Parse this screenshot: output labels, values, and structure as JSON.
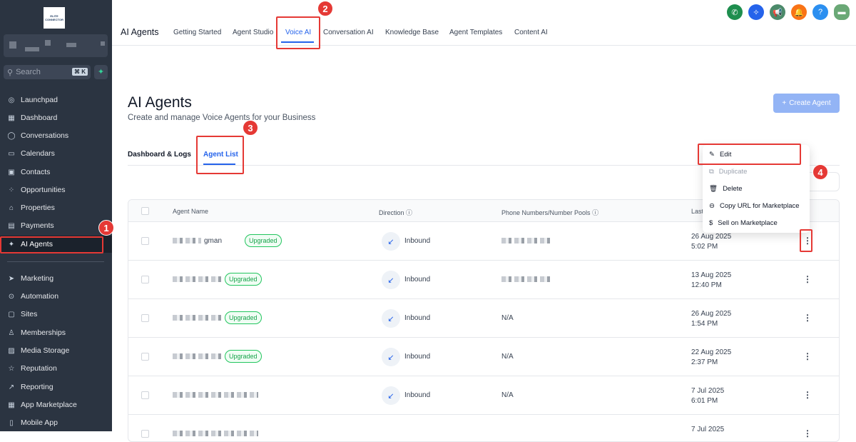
{
  "sidebar": {
    "logo_text": "ELITE CONNECTOR",
    "search_placeholder": "Search",
    "shortcut": "⌘ K",
    "items": [
      {
        "label": "Launchpad",
        "icon": "◎"
      },
      {
        "label": "Dashboard",
        "icon": "▦"
      },
      {
        "label": "Conversations",
        "icon": "◯"
      },
      {
        "label": "Calendars",
        "icon": "▭"
      },
      {
        "label": "Contacts",
        "icon": "▣"
      },
      {
        "label": "Opportunities",
        "icon": "⁘"
      },
      {
        "label": "Properties",
        "icon": "⌂"
      },
      {
        "label": "Payments",
        "icon": "▤"
      },
      {
        "label": "AI Agents",
        "icon": "✦",
        "active": true
      },
      {
        "label": "Marketing",
        "icon": "➤"
      },
      {
        "label": "Automation",
        "icon": "⊙"
      },
      {
        "label": "Sites",
        "icon": "▢"
      },
      {
        "label": "Memberships",
        "icon": "♙"
      },
      {
        "label": "Media Storage",
        "icon": "▨"
      },
      {
        "label": "Reputation",
        "icon": "☆"
      },
      {
        "label": "Reporting",
        "icon": "↗"
      },
      {
        "label": "App Marketplace",
        "icon": "▦"
      },
      {
        "label": "Mobile App",
        "icon": "▯"
      }
    ]
  },
  "header": {
    "title": "AI Agents",
    "tabs": [
      "Getting Started",
      "Agent Studio",
      "Voice AI",
      "Conversation AI",
      "Knowledge Base",
      "Agent Templates",
      "Content AI"
    ],
    "active_tab": "Voice AI"
  },
  "page": {
    "title": "AI Agents",
    "subtitle": "Create and manage Voice Agents for your Business",
    "create_button": "Create Agent",
    "subtabs": [
      "Dashboard & Logs",
      "Agent List"
    ]
  },
  "table": {
    "headers": [
      "Agent Name",
      "Direction",
      "Phone Numbers/Number Pools",
      "Last"
    ],
    "rows": [
      {
        "name_suffix": "gman",
        "badge": "Upgraded",
        "direction": "Inbound",
        "phone": "",
        "date": "26 Aug 2025",
        "time": "5:02 PM"
      },
      {
        "name_suffix": "",
        "badge": "Upgraded",
        "direction": "Inbound",
        "phone": "",
        "date": "13 Aug 2025",
        "time": "12:40 PM"
      },
      {
        "name_suffix": "",
        "badge": "Upgraded",
        "direction": "Inbound",
        "phone": "N/A",
        "date": "26 Aug 2025",
        "time": "1:54 PM"
      },
      {
        "name_suffix": "",
        "badge": "Upgraded",
        "direction": "Inbound",
        "phone": "N/A",
        "date": "22 Aug 2025",
        "time": "2:37 PM"
      },
      {
        "name_suffix": "",
        "badge": "",
        "direction": "Inbound",
        "phone": "N/A",
        "date": "7 Jul 2025",
        "time": "6:01 PM"
      },
      {
        "name_suffix": "",
        "badge": "",
        "direction": "",
        "phone": "",
        "date": "7 Jul 2025",
        "time": ""
      }
    ]
  },
  "menu": {
    "items": [
      {
        "label": "Edit",
        "icon": "✎"
      },
      {
        "label": "Duplicate",
        "icon": "⧉",
        "disabled": true
      },
      {
        "label": "Delete",
        "icon": "🗑"
      },
      {
        "label": "Copy URL for Marketplace",
        "icon": "⊖"
      },
      {
        "label": "Sell on Marketplace",
        "icon": "$"
      }
    ]
  },
  "annotations": [
    "1",
    "2",
    "3",
    "4"
  ],
  "colors": {
    "accent": "#2563eb",
    "annotation": "#e53935",
    "sidebar": "#2b3441"
  }
}
